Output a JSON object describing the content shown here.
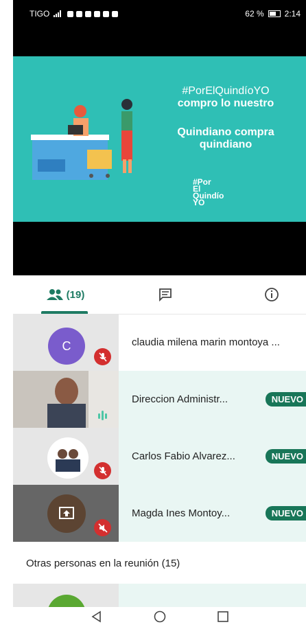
{
  "status_bar": {
    "carrier": "TIGO",
    "battery_percent": "62 %",
    "time": "2:14"
  },
  "banner": {
    "hashtag": "#PorElQuindíoYO",
    "line2": "compro lo nuestro",
    "line3": "Quindiano compra",
    "line4": "quindiano",
    "logo_1": "#Por",
    "logo_2": "El",
    "logo_3": "Quindío",
    "logo_4": "YO"
  },
  "tabs": {
    "people_count": "(19)",
    "active": "people"
  },
  "participants": [
    {
      "name": "claudia milena marin montoya ...",
      "tile": "avatar",
      "initial": "C",
      "muted": true,
      "badge": ""
    },
    {
      "name": "Direccion Administr...",
      "tile": "video",
      "muted": false,
      "speaking": true,
      "badge": "NUEVO"
    },
    {
      "name": "Carlos Fabio Alvarez...",
      "tile": "photo",
      "muted": true,
      "badge": "NUEVO"
    },
    {
      "name": "Magda Ines Montoy...",
      "tile": "screen-share",
      "muted": true,
      "badge": "NUEVO"
    }
  ],
  "section_label": "Otras personas en la reunión (15)",
  "colors": {
    "accent": "#1e7b63",
    "badge": "#187658",
    "banner": "#2fbfb5",
    "mute": "#d32f2f",
    "row_highlight": "#e9f6f3"
  }
}
